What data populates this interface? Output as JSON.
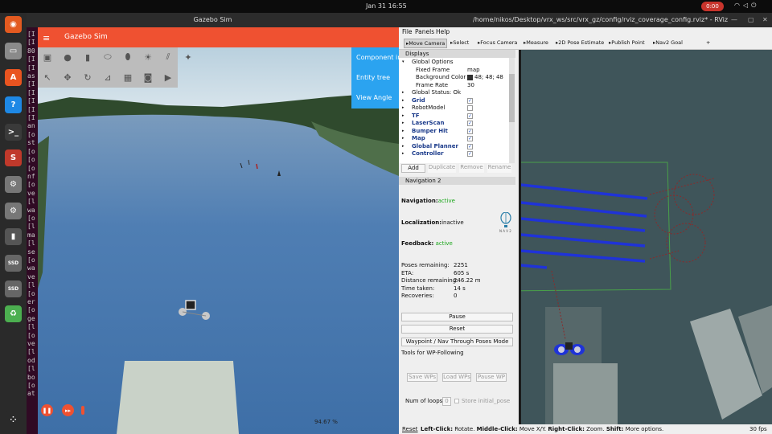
{
  "topbar": {
    "activities": "",
    "clock": "Jan 31  16:55",
    "record": "0:00"
  },
  "dock": {
    "items": [
      {
        "icon": "firefox-icon",
        "color": "#e35a20",
        "glyph": "◉"
      },
      {
        "icon": "files-icon",
        "color": "#8a8a8a",
        "glyph": "▭"
      },
      {
        "icon": "app-center-icon",
        "color": "#e95420",
        "glyph": "A"
      },
      {
        "icon": "help-icon",
        "color": "#1e88e5",
        "glyph": "?"
      },
      {
        "icon": "terminal-icon",
        "color": "#3a3a3a",
        "glyph": ">_"
      },
      {
        "icon": "text-editor-icon",
        "color": "#c0392b",
        "glyph": "S"
      },
      {
        "icon": "settings-icon",
        "color": "#777",
        "glyph": "⚙"
      },
      {
        "icon": "settings-icon-2",
        "color": "#777",
        "glyph": "⚙"
      },
      {
        "icon": "usb-drive-icon",
        "color": "#555",
        "glyph": "▮"
      },
      {
        "icon": "ssd-icon",
        "color": "#666",
        "glyph": "SSD"
      },
      {
        "icon": "ssd-icon-2",
        "color": "#666",
        "glyph": "SSD"
      },
      {
        "icon": "trash-icon",
        "color": "#4caf50",
        "glyph": "♻"
      },
      {
        "icon": "show-apps-icon",
        "color": "#2a2a2a",
        "glyph": "⁘"
      }
    ]
  },
  "terminal": {
    "lines": [
      "[I",
      "[I",
      "80",
      "[I",
      "[I",
      "as",
      "[I",
      "[I",
      "[I",
      "[I",
      "[I",
      "an",
      "[o",
      "st",
      "[o",
      "[o",
      "[o",
      "nf",
      "[o",
      "ve",
      "[l",
      "wa",
      "[o",
      "[l",
      "ma",
      "[l",
      "se",
      "[o",
      "wa",
      "ve",
      "[l",
      "[o",
      "er",
      "[o",
      "ge",
      "[l",
      "[o",
      "ve",
      "[l",
      "od",
      "[l",
      "bo",
      "[o",
      "at"
    ]
  },
  "gazebo": {
    "window_title": "Gazebo Sim",
    "header_title": "Gazebo Sim",
    "side_items": [
      "Component inspector",
      "Entity tree",
      "View Angle"
    ],
    "rtf": "94.67 %",
    "tools_row1": [
      "box-icon",
      "sphere-icon",
      "cylinder-icon",
      "capsule-icon",
      "ellipsoid-icon",
      "sun-icon",
      "directional-light-icon",
      "spot-light-icon"
    ],
    "tools_row2": [
      "select-icon",
      "translate-icon",
      "rotate-icon",
      "snap-icon",
      "grid-icon",
      "camera-icon",
      "video-icon"
    ]
  },
  "rviz": {
    "window_title": "/home/nikos/Desktop/vrx_ws/src/vrx_gz/config/rviz_coverage_config.rviz* - RViz",
    "menu": [
      "File",
      "Panels",
      "Help"
    ],
    "toolbar": [
      "Move Camera",
      "Select",
      "Focus Camera",
      "Measure",
      "2D Pose Estimate",
      "Publish Point",
      "Nav2 Goal"
    ],
    "displays_title": "Displays",
    "displays": [
      {
        "label": "Global Options",
        "indent": 0,
        "check": "",
        "bold": false
      },
      {
        "label": "Fixed Frame",
        "indent": 1,
        "value": "map",
        "check": "",
        "bold": false
      },
      {
        "label": "Background Color",
        "indent": 1,
        "value": "48; 48; 48",
        "check": "",
        "bold": false
      },
      {
        "label": "Frame Rate",
        "indent": 1,
        "value": "30",
        "check": "",
        "bold": false
      },
      {
        "label": "Global Status: Ok",
        "indent": 0,
        "check": "",
        "bold": false
      },
      {
        "label": "Grid",
        "indent": 0,
        "check": "✓",
        "bold": true
      },
      {
        "label": "RobotModel",
        "indent": 0,
        "check": " ",
        "bold": false
      },
      {
        "label": "TF",
        "indent": 0,
        "check": "✓",
        "bold": true
      },
      {
        "label": "LaserScan",
        "indent": 0,
        "check": "✓",
        "bold": true
      },
      {
        "label": "Bumper Hit",
        "indent": 0,
        "check": "✓",
        "bold": true
      },
      {
        "label": "Map",
        "indent": 0,
        "check": "✓",
        "bold": true
      },
      {
        "label": "Global Planner",
        "indent": 0,
        "check": "✓",
        "bold": true
      },
      {
        "label": "Controller",
        "indent": 0,
        "check": "✓",
        "bold": true
      }
    ],
    "display_buttons": [
      "Add",
      "Duplicate",
      "Remove",
      "Rename"
    ],
    "nav_title": "Navigation 2",
    "navigation_label": "Navigation:",
    "navigation_value": "active",
    "localization_label": "Localization:",
    "localization_value": "inactive",
    "feedback_label": "Feedback:",
    "feedback_value": "active",
    "nav2_logo_text": "N A V 2",
    "stats": [
      {
        "label": "Poses remaining:",
        "value": "2251"
      },
      {
        "label": "ETA:",
        "value": "605 s"
      },
      {
        "label": "Distance remaining:",
        "value": "246.22 m"
      },
      {
        "label": "Time taken:",
        "value": "14 s"
      },
      {
        "label": "Recoveries:",
        "value": "0"
      }
    ],
    "pause_button": "Pause",
    "reset_button": "Reset",
    "waypoint_button": "Waypoint / Nav Through Poses Mode",
    "wp_title": "Tools for WP-Following",
    "wp_buttons": [
      "Save WPs",
      "Load WPs",
      "Pause WP"
    ],
    "loops_label": "Num of loops",
    "loops_value": "0",
    "store_initial": "Store initial_pose",
    "status_reset": "Reset",
    "status_text": {
      "left_click": "Left-Click:",
      "left_click_desc": "Rotate.",
      "middle_click": "Middle-Click:",
      "middle_click_desc": "Move X/Y.",
      "right_click": "Right-Click:",
      "right_click_desc": "Zoom.",
      "shift": "Shift:",
      "shift_desc": "More options."
    },
    "fps": "30 fps"
  }
}
